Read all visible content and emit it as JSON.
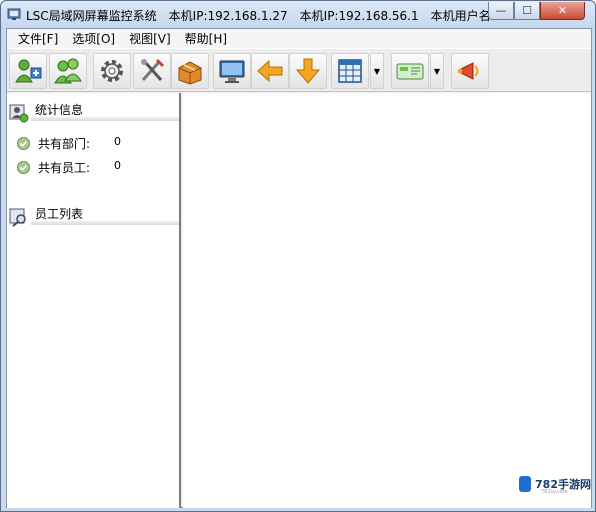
{
  "window": {
    "title": "LSC局域网屏幕监控系统　本机IP:192.168.1.27　本机IP:192.168.56.1　本机用户名：HY...",
    "controls": {
      "minimize": "—",
      "maximize": "☐",
      "close": "✕"
    }
  },
  "menu": {
    "items": [
      "文件[F]",
      "选项[O]",
      "视图[V]",
      "帮助[H]"
    ]
  },
  "toolbar": {
    "buttons": [
      {
        "icon": "add-user-icon"
      },
      {
        "icon": "users-icon"
      },
      {
        "icon": "settings-gear-icon"
      },
      {
        "icon": "tools-icon"
      },
      {
        "icon": "package-icon"
      },
      {
        "icon": "monitor-icon"
      },
      {
        "icon": "arrow-left-icon"
      },
      {
        "icon": "arrow-down-icon"
      },
      {
        "icon": "grid-layout-icon"
      },
      {
        "icon": "network-card-icon"
      },
      {
        "icon": "megaphone-icon"
      }
    ],
    "dropdown_glyph": "▼"
  },
  "left": {
    "stats": {
      "title": "统计信息",
      "rows": [
        {
          "label": "共有部门:",
          "value": "0"
        },
        {
          "label": "共有员工:",
          "value": "0"
        }
      ]
    },
    "employees": {
      "title": "员工列表"
    }
  },
  "watermark": {
    "text": "782手游网",
    "sub": "782sy.com"
  },
  "colors": {
    "title_bar": "#c5d7ef",
    "close_button": "#c94a33",
    "frame": "#5a6f8c"
  }
}
